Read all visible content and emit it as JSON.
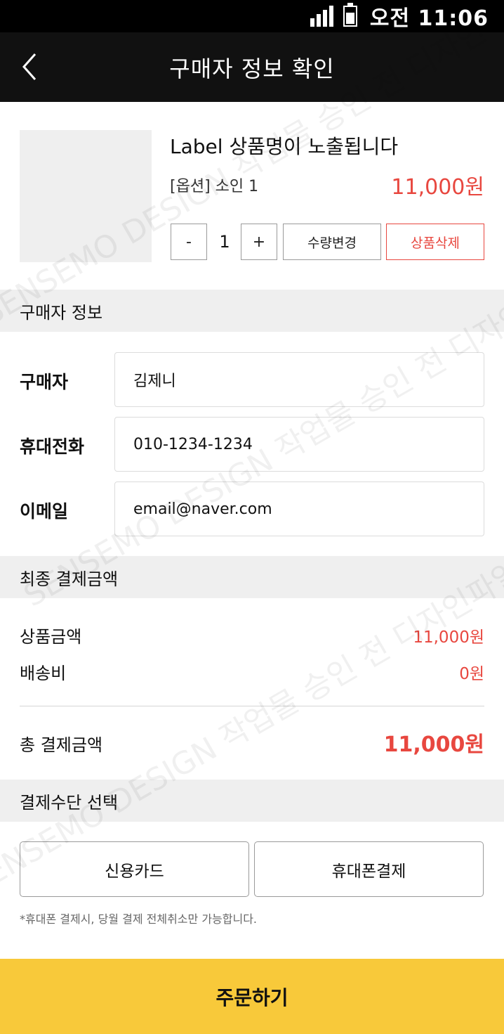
{
  "status_bar": {
    "time": "오전 11:06"
  },
  "header": {
    "title": "구매자 정보 확인",
    "back_icon": "chevron-left-icon"
  },
  "product": {
    "name": "Label 상품명이 노출됩니다",
    "option": "[옵션] 소인 1",
    "price": "11,000원",
    "quantity": "1",
    "minus_label": "-",
    "plus_label": "+",
    "change_quantity_label": "수량변경",
    "delete_label": "상품삭제"
  },
  "buyer_section": {
    "title": "구매자 정보",
    "name_label": "구매자",
    "name_value": "김제니",
    "phone_label": "휴대전화",
    "phone_value": "010-1234-1234",
    "email_label": "이메일",
    "email_value": "email@naver.com"
  },
  "payment_summary": {
    "title": "최종 결제금액",
    "product_amount_label": "상품금액",
    "product_amount_value": "11,000원",
    "shipping_label": "배송비",
    "shipping_value": "0원",
    "total_label": "총 결제금액",
    "total_value": "11,000원"
  },
  "payment_method": {
    "title": "결제수단 선택",
    "card_label": "신용카드",
    "phone_label": "휴대폰결제",
    "note": "*휴대폰 결제시, 당월 결제 전체취소만 가능합니다."
  },
  "order_button": {
    "label": "주문하기"
  },
  "watermark": {
    "text": "SENSEMO DESIGN 작업물 승인 전 디자인파일입니다 무단도용 금지"
  },
  "colors": {
    "accent_red": "#e8473f",
    "order_yellow": "#f8c93a",
    "header_black": "#111111"
  }
}
